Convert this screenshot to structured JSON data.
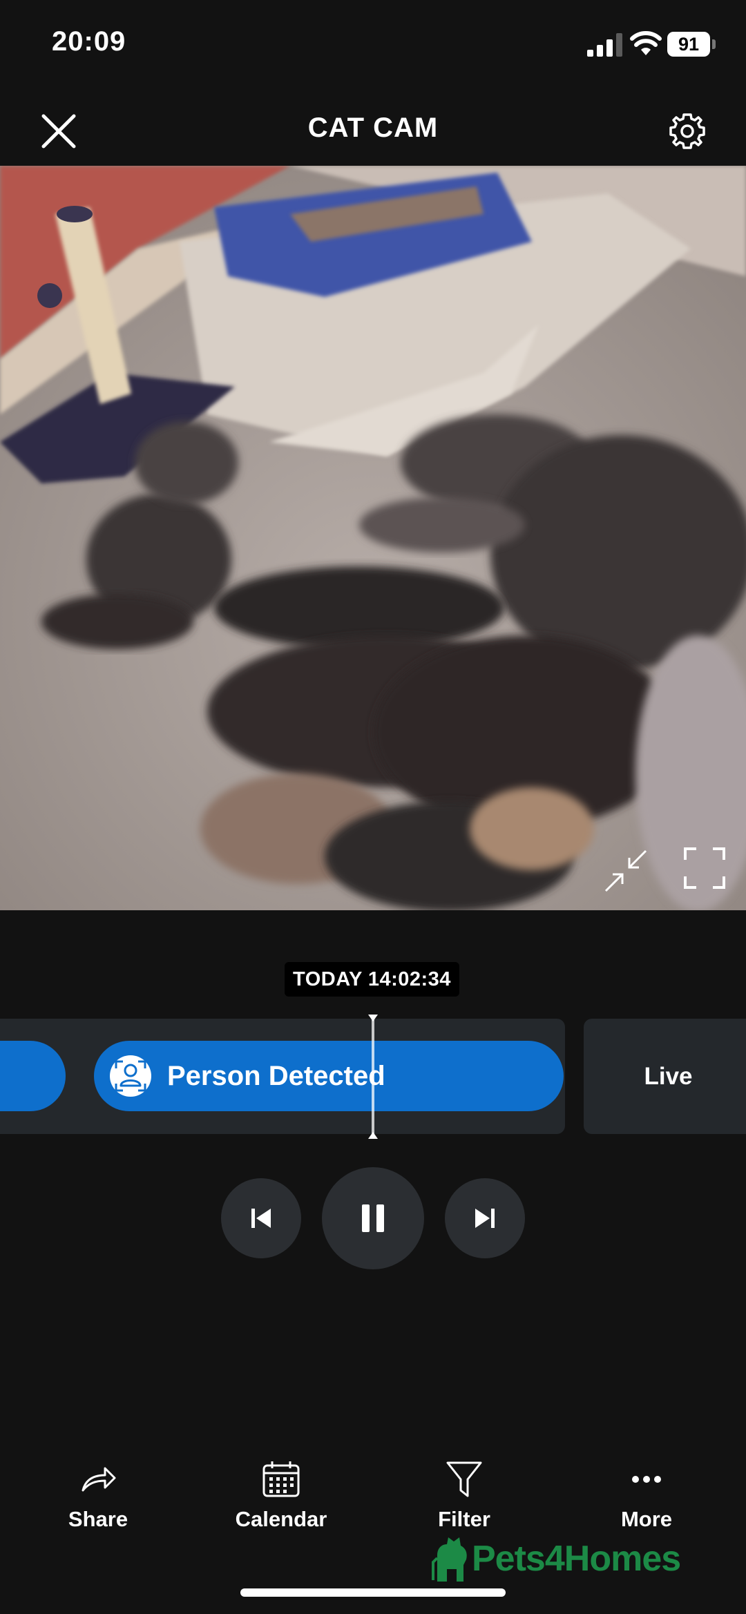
{
  "status_bar": {
    "time": "20:09",
    "battery": "91",
    "icons": [
      "signal-icon",
      "wifi-icon",
      "battery-icon"
    ]
  },
  "header": {
    "title": "CAT CAM",
    "close_icon": "close-icon",
    "settings_icon": "gear-icon"
  },
  "video": {
    "description_icons": [
      "picture-in-picture-icon",
      "fullscreen-icon"
    ]
  },
  "timeline": {
    "timestamp": "TODAY 14:02:34",
    "events": [
      {
        "label": "",
        "type": "event"
      },
      {
        "label": "Person Detected",
        "type": "person",
        "icon": "person-detected-icon"
      }
    ],
    "live_label": "Live"
  },
  "controls": {
    "prev_icon": "skip-previous-icon",
    "pause_icon": "pause-icon",
    "next_icon": "skip-next-icon"
  },
  "bottom_bar": {
    "items": [
      {
        "label": "Share",
        "icon": "share-icon"
      },
      {
        "label": "Calendar",
        "icon": "calendar-icon"
      },
      {
        "label": "Filter",
        "icon": "filter-icon"
      },
      {
        "label": "More",
        "icon": "more-icon"
      }
    ]
  },
  "watermark": {
    "text": "Pets4Homes",
    "color": "#1c8a46"
  },
  "colors": {
    "background": "#121212",
    "accent": "#0e6fcc",
    "panel": "#24282c"
  }
}
